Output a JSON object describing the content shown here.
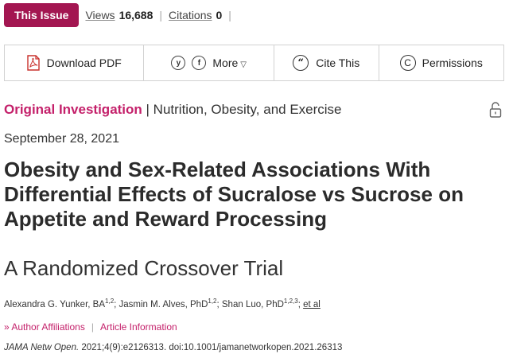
{
  "metrics": {
    "issue_badge": "This Issue",
    "views_label": "Views",
    "views_value": "16,688",
    "citations_label": "Citations",
    "citations_value": "0",
    "separator": "|"
  },
  "toolbar": {
    "download_pdf": "Download PDF",
    "twitter_glyph": "y",
    "facebook_glyph": "f",
    "more": "More",
    "more_caret": "▽",
    "cite_glyph": "“",
    "cite": "Cite This",
    "permissions_glyph": "C",
    "permissions": "Permissions"
  },
  "article": {
    "category_main": "Original Investigation",
    "category_rest": " | Nutrition, Obesity, and Exercise",
    "date": "September 28, 2021",
    "title": "Obesity and Sex-Related Associations With Differential Effects of Sucralose vs Sucrose on Appetite and Reward Processing",
    "subtitle": "A Randomized Crossover Trial",
    "authors": [
      {
        "name": "Alexandra G. Yunker, BA",
        "sup": "1,2",
        "sep": "; "
      },
      {
        "name": "Jasmin M. Alves, PhD",
        "sup": "1,2",
        "sep": "; "
      },
      {
        "name": "Shan Luo, PhD",
        "sup": "1,2,3",
        "sep": "; "
      }
    ],
    "et_al": "et al",
    "author_affiliations": "» Author Affiliations",
    "affil_sep": "|",
    "article_information": "Article Information",
    "journal": "JAMA Netw Open.",
    "citation_rest": " 2021;4(9):e2126313. doi:10.1001/jamanetworkopen.2021.26313"
  },
  "icons": {
    "download": "pdf-file-icon",
    "twitter": "twitter-icon",
    "facebook": "facebook-icon",
    "cite": "quote-icon",
    "permissions": "copyright-icon",
    "access": "open-lock-icon"
  },
  "colors": {
    "brand_badge": "#a31651",
    "brand_link": "#c4206a"
  }
}
